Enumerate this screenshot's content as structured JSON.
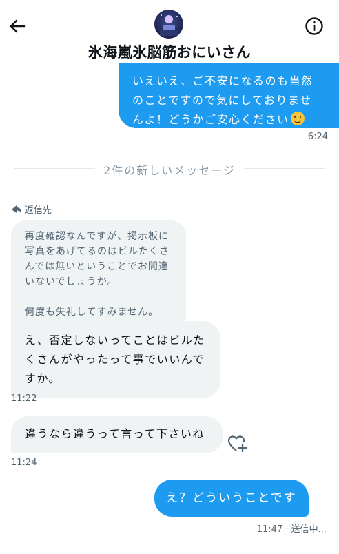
{
  "header": {
    "title": "氷海嵐氷脳筋おにいさん",
    "back_icon": "back-arrow-icon",
    "info_icon": "info-icon"
  },
  "messages": [
    {
      "direction": "sent",
      "text": "いえいえ、ご不安になるのも当然\nのことですので気にしておりませ\nんよ！どうかご安心ください",
      "emoji": "hugging-face",
      "time": "6:24"
    }
  ],
  "divider": {
    "text": "2件の新しいメッセージ"
  },
  "reply": {
    "label": "返信先",
    "quoted_text": "再度確認なんですが、掲示板に\n写真をあげてるのはビルたくさ\nんでは無いということでお間違\nいないでしょうか。\n\n何度も失礼してすみません。"
  },
  "received": [
    {
      "text": "え、否定しないってことはビルたくさんがやったって事でいいんですか。",
      "time": "11:22"
    },
    {
      "text": "違うなら違うって言って下さいね",
      "time": "11:24"
    }
  ],
  "last_sent": {
    "text": "え？どういうことですか？",
    "status": "11:47 · 送信中..."
  },
  "colors": {
    "accent": "#1d9bf0",
    "bubble_received": "#eff3f4",
    "muted": "#536471"
  }
}
